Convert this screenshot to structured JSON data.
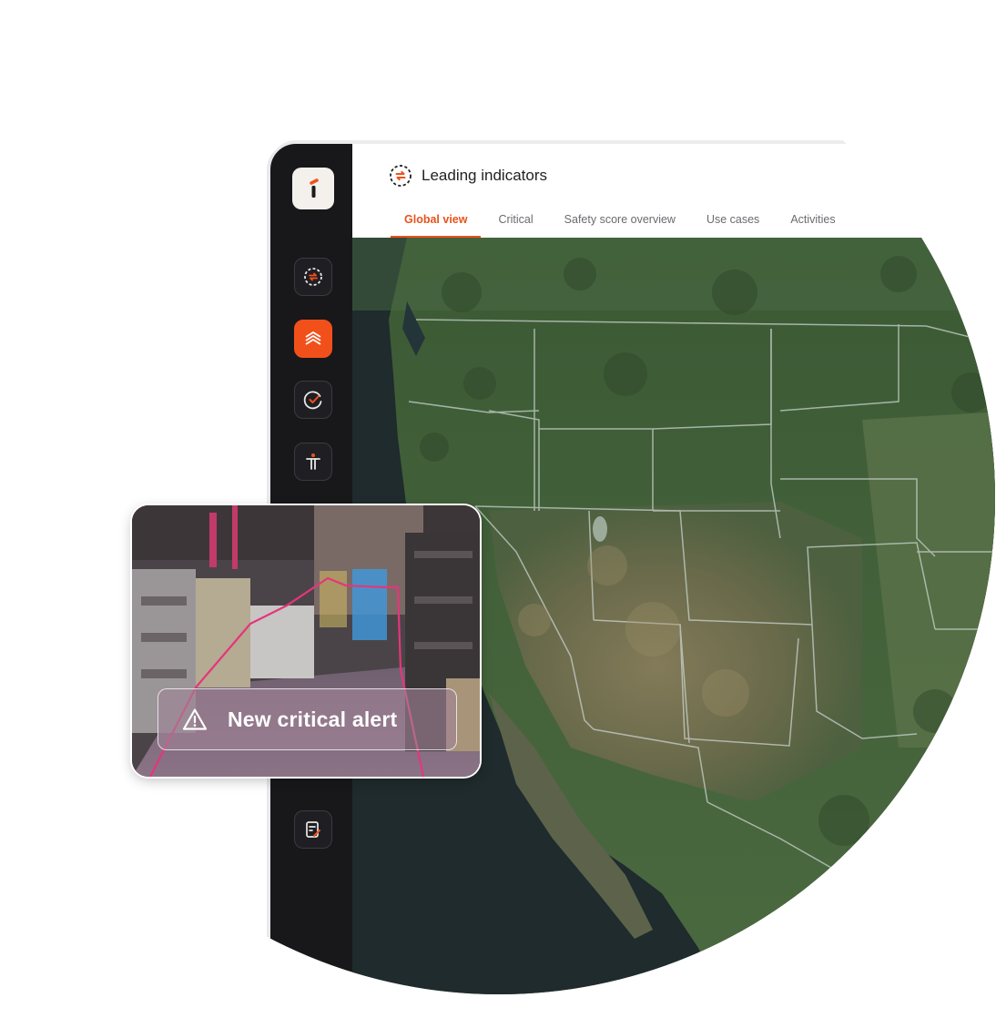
{
  "header": {
    "title": "Leading indicators",
    "tabs": [
      {
        "label": "Global view",
        "active": true
      },
      {
        "label": "Critical",
        "active": false
      },
      {
        "label": "Safety score overview",
        "active": false
      },
      {
        "label": "Use cases",
        "active": false
      },
      {
        "label": "Activities",
        "active": false
      }
    ]
  },
  "sidebar": {
    "items": [
      {
        "icon": "leading-indicators-icon",
        "active": false
      },
      {
        "icon": "layers-icon",
        "active": true
      },
      {
        "icon": "check-circle-icon",
        "active": false
      },
      {
        "icon": "person-icon",
        "active": false
      },
      {
        "icon": "report-edit-icon",
        "active": false
      }
    ]
  },
  "alert": {
    "text": "New critical alert",
    "icon": "warning-icon"
  },
  "colors": {
    "accent": "#f2501b",
    "sidebar": "#18181b",
    "map": "#3d5535"
  }
}
